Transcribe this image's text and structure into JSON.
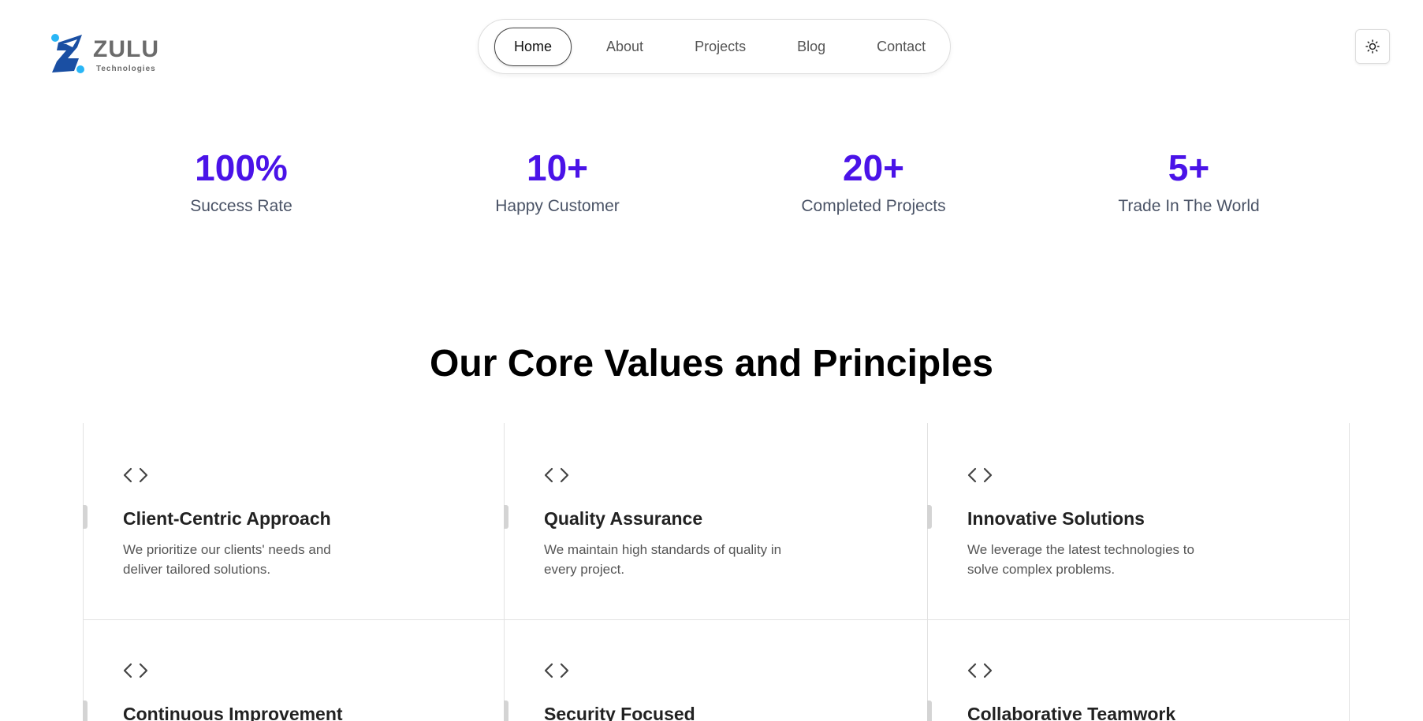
{
  "brand": {
    "name": "ZULU",
    "tagline": "Technologies",
    "colors": {
      "primary": "#1a4fa3",
      "accent": "#29b6f6"
    }
  },
  "nav": {
    "items": [
      {
        "label": "Home",
        "active": true
      },
      {
        "label": "About",
        "active": false
      },
      {
        "label": "Projects",
        "active": false
      },
      {
        "label": "Blog",
        "active": false
      },
      {
        "label": "Contact",
        "active": false
      }
    ]
  },
  "theme_toggle": {
    "icon": "sun-icon"
  },
  "stats": [
    {
      "value": "100%",
      "label": "Success Rate"
    },
    {
      "value": "10+",
      "label": "Happy Customer"
    },
    {
      "value": "20+",
      "label": "Completed Projects"
    },
    {
      "value": "5+",
      "label": "Trade In The World"
    }
  ],
  "values_section": {
    "title": "Our Core Values and Principles",
    "cards": [
      {
        "icon": "code-icon",
        "title": "Client-Centric Approach",
        "description": "We prioritize our clients' needs and deliver tailored solutions."
      },
      {
        "icon": "code-icon",
        "title": "Quality Assurance",
        "description": "We maintain high standards of quality in every project."
      },
      {
        "icon": "code-icon",
        "title": "Innovative Solutions",
        "description": "We leverage the latest technologies to solve complex problems."
      },
      {
        "icon": "code-icon",
        "title": "Continuous Improvement",
        "description": ""
      },
      {
        "icon": "code-icon",
        "title": "Security Focused",
        "description": ""
      },
      {
        "icon": "code-icon",
        "title": "Collaborative Teamwork",
        "description": ""
      }
    ]
  },
  "colors": {
    "stat_value": "#4a13e8",
    "stat_label": "#4a5366",
    "card_border": "#e2e2e2"
  }
}
